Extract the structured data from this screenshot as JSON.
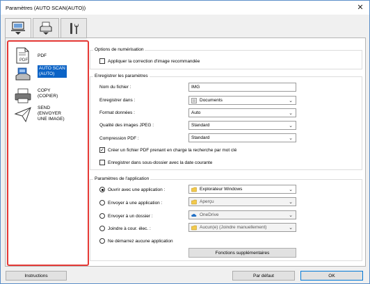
{
  "window": {
    "title": "Paramètres (AUTO SCAN(AUTO))",
    "close_glyph": "✕"
  },
  "tabs": [
    {
      "icon": "scan-from-computer-icon"
    },
    {
      "icon": "scan-from-panel-icon"
    },
    {
      "icon": "general-settings-tools-icon"
    }
  ],
  "sidebar": {
    "items": [
      {
        "label": "PDF",
        "icon": "pdf-document-icon"
      },
      {
        "label": "AUTO SCAN\n(AUTO)",
        "icon": "auto-scan-scanner-icon",
        "selected": true
      },
      {
        "label": "COPY\n(COPIER)",
        "icon": "copy-printer-icon"
      },
      {
        "label": "SEND\n(ENVOYER\nUNE IMAGE)",
        "icon": "send-paper-plane-icon"
      }
    ]
  },
  "scan_options": {
    "group_label": "Options de numérisation",
    "apply_correction": {
      "label": "Appliquer la correction d'image recommandée",
      "checked": false
    }
  },
  "save_settings": {
    "group_label": "Enregistrer les paramètres",
    "file_name": {
      "label": "Nom du fichier :",
      "value": "IMG"
    },
    "save_in": {
      "label": "Enregistrer dans :",
      "value": "Documents"
    },
    "data_format": {
      "label": "Format données :",
      "value": "Auto"
    },
    "jpeg_quality": {
      "label": "Qualité des images JPEG :",
      "value": "Standard"
    },
    "pdf_compression": {
      "label": "Compression PDF :",
      "value": "Standard"
    },
    "searchable_pdf": {
      "label": "Créer un fichier PDF prenant en charge la recherche par mot clé",
      "checked": true
    },
    "subfolder_date": {
      "label": "Enregistrer dans sous-dossier avec la date courante",
      "checked": false
    }
  },
  "app_settings": {
    "group_label": "Paramètres de l'application",
    "open_with": {
      "label": "Ouvrir avec une application :",
      "value": "Explorateur Windows",
      "selected": true
    },
    "send_to_app": {
      "label": "Envoyer à une application :",
      "value": "Aperçu",
      "selected": false
    },
    "send_to_folder": {
      "label": "Envoyer à un dossier :",
      "value": "OneDrive",
      "selected": false
    },
    "attach_email": {
      "label": "Joindre à cour. élec. :",
      "value": "Aucun(e) (Joindre manuellement)",
      "selected": false
    },
    "no_app": {
      "label": "Ne démarrez aucune application",
      "selected": false
    },
    "more_functions": "Fonctions supplémentaires"
  },
  "footer": {
    "instructions": "Instructions",
    "defaults": "Par défaut",
    "ok": "OK"
  }
}
